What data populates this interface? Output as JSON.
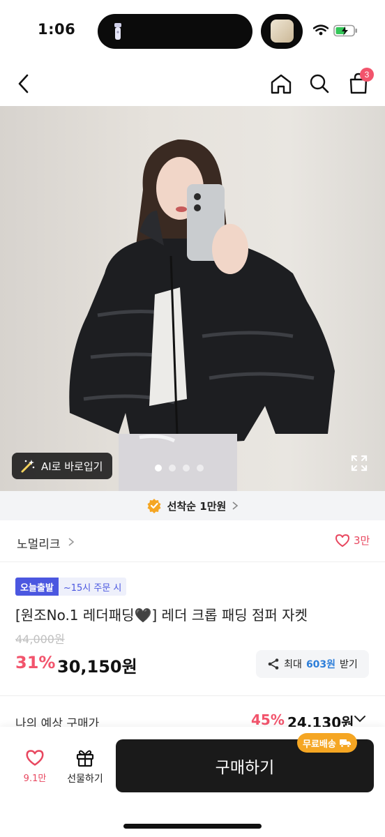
{
  "status_bar": {
    "time": "1:06"
  },
  "nav": {
    "cart_count": "3"
  },
  "hero": {
    "ai_button_label": "AI로 바로입기",
    "image_count": 4,
    "active_image_index": 0
  },
  "coupon_strip": {
    "label": "선착순 1만원"
  },
  "brand": {
    "name": "노멀리크",
    "like_count": "3만"
  },
  "product": {
    "tag_today": "오늘출발",
    "tag_time": "~15시 주문 시",
    "title": "[원조No.1 레더패딩🖤] 레더 크롭 패딩 점퍼 자켓",
    "original_price": "44,000원",
    "discount_rate": "31%",
    "sale_price": "30,150원",
    "coupon_prefix": "최대",
    "coupon_amount": "603원",
    "coupon_suffix": "받기"
  },
  "expected": {
    "label": "나의 예상 구매가",
    "rate": "45%",
    "price": "24,130원"
  },
  "bottom_bar": {
    "like_count": "9.1만",
    "gift_label": "선물하기",
    "buy_label": "구매하기",
    "free_shipping_label": "무료배송"
  },
  "colors": {
    "accent_pink": "#f2546c",
    "blue_tag": "#4b57e0",
    "coupon_blue": "#2d7ed9",
    "shipping_orange": "#f5a623",
    "buy_button": "#1a1a1a"
  }
}
